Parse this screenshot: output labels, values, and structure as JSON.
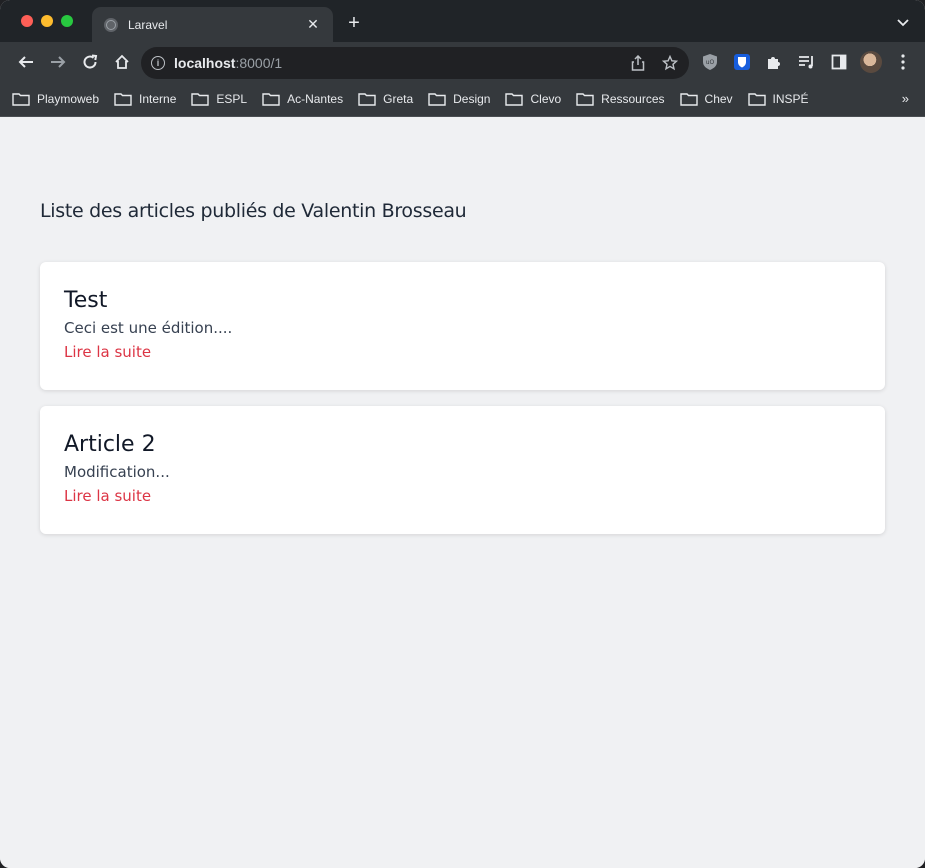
{
  "browser": {
    "tab_title": "Laravel",
    "tab_close": "✕",
    "new_tab": "+",
    "url_host": "localhost",
    "url_rest": ":8000/1",
    "bookmarks": [
      "Playmoweb",
      "Interne",
      "ESPL",
      "Ac-Nantes",
      "Greta",
      "Design",
      "Clevo",
      "Ressources",
      "Chev",
      "INSPÉ"
    ],
    "bookmarks_more": "»"
  },
  "page": {
    "heading": "Liste des articles publiés de Valentin Brosseau",
    "articles": [
      {
        "title": "Test",
        "excerpt": "Ceci est une édition....",
        "link": "Lire la suite"
      },
      {
        "title": "Article 2",
        "excerpt": "Modification...",
        "link": "Lire la suite"
      }
    ]
  },
  "colors": {
    "link": "#dc3545",
    "page_bg": "#f0f1f3",
    "card_bg": "#ffffff"
  }
}
